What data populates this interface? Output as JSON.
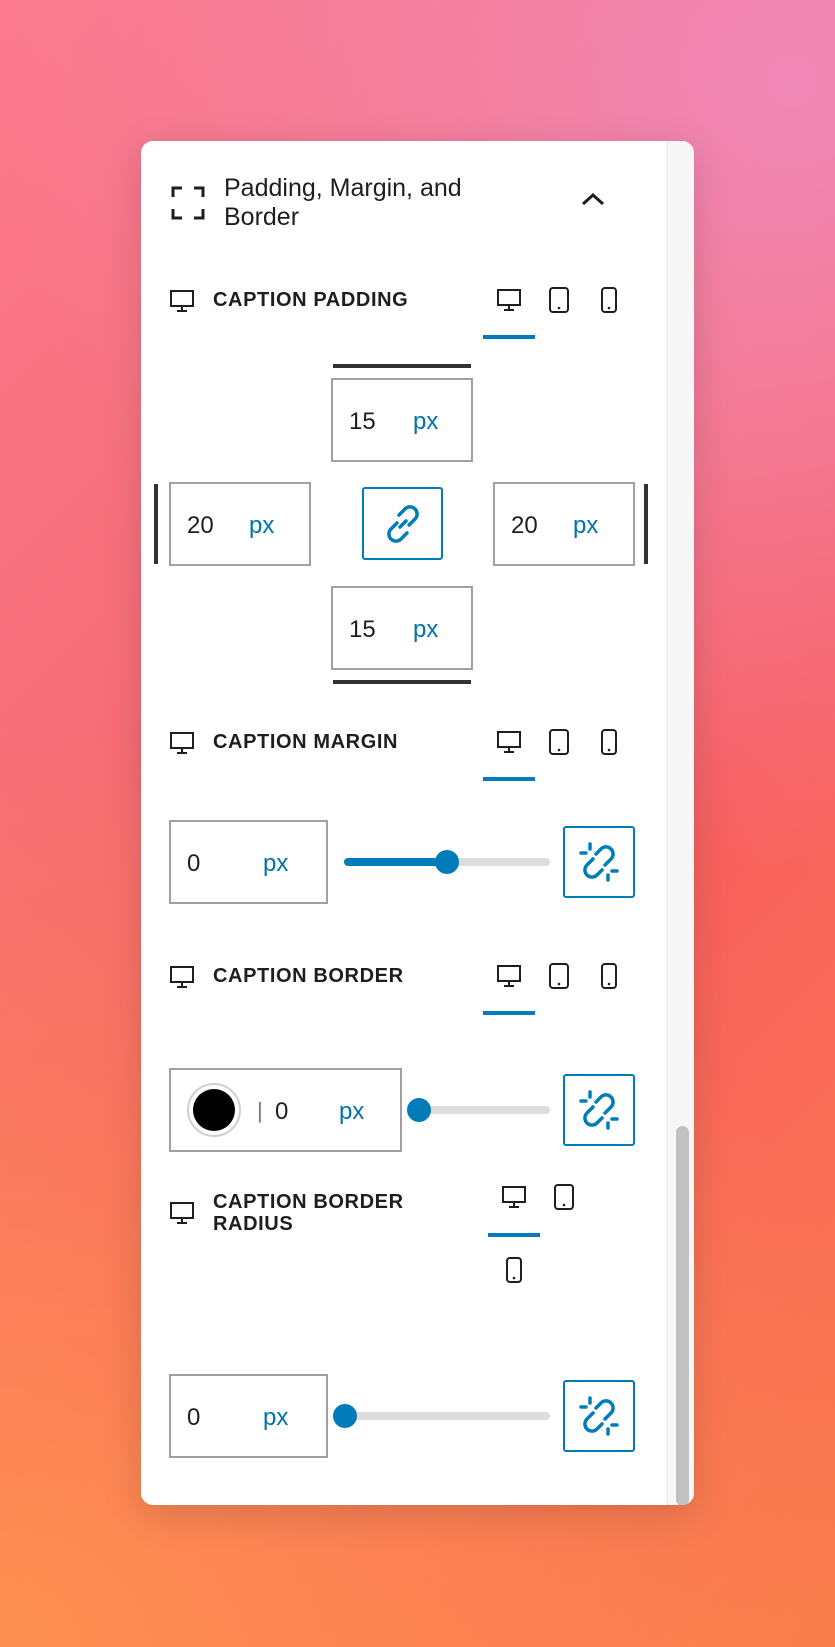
{
  "panel": {
    "title": "Padding, Margin, and Border"
  },
  "sections": {
    "padding": {
      "label": "CAPTION PADDING",
      "top": {
        "value": "15",
        "unit": "px"
      },
      "left": {
        "value": "20",
        "unit": "px"
      },
      "right": {
        "value": "20",
        "unit": "px"
      },
      "bottom": {
        "value": "15",
        "unit": "px"
      }
    },
    "margin": {
      "label": "CAPTION MARGIN",
      "value": "0",
      "unit": "px",
      "slider_level": 0.5
    },
    "border": {
      "label": "CAPTION BORDER",
      "value": "0",
      "unit": "px",
      "separator": "|",
      "color": "#000000",
      "slider_level": 0
    },
    "radius": {
      "label_line1": "CAPTION BORDER",
      "label_line2": "RADIUS",
      "value": "0",
      "unit": "px",
      "slider_level": 0
    }
  },
  "colors": {
    "accent": "#007cba",
    "unit_text": "#0073aa"
  },
  "icons": {
    "section": "border-corners-icon",
    "collapse": "chevron-up-icon",
    "desktop": "desktop-icon",
    "tablet": "tablet-icon",
    "mobile": "mobile-icon",
    "linked": "link-icon",
    "unlinked": "unlink-icon"
  }
}
